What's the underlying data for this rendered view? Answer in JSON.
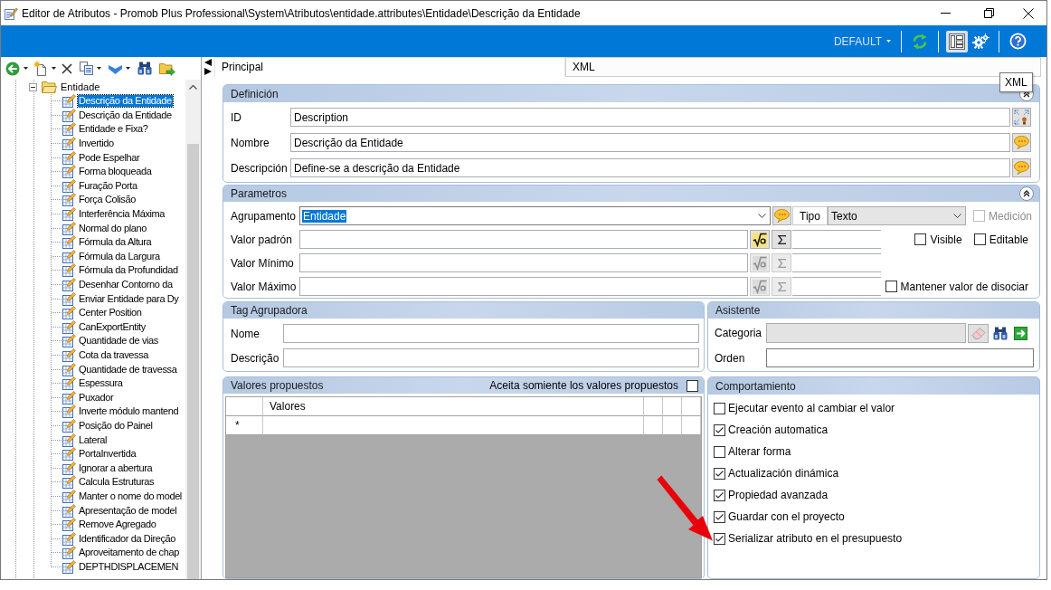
{
  "window": {
    "title": "Editor de Atributos - Promob Plus Professional\\System\\Atributos\\entidade.attributes\\Entidade\\Descrição da Entidade"
  },
  "header_bar": {
    "profile": "DEFAULT",
    "tool_groups": [
      [
        {
          "kind": "refresh",
          "on": false
        }
      ],
      [
        {
          "kind": "layout",
          "on": true
        },
        {
          "kind": "settings",
          "on": false
        }
      ],
      [
        {
          "kind": "help",
          "on": false
        }
      ]
    ]
  },
  "tree_toolbar": [
    {
      "kind": "back",
      "dropdown": true
    },
    {
      "kind": "new",
      "dropdown": true
    },
    {
      "kind": "delete",
      "dropdown": false
    },
    {
      "kind": "copy",
      "dropdown": true
    },
    {
      "kind": "move_down",
      "dropdown": true
    },
    {
      "kind": "find",
      "dropdown": false
    },
    {
      "kind": "import",
      "dropdown": false
    }
  ],
  "tree": {
    "label": "Entidade",
    "expanded": true,
    "children": [
      {
        "label": "Descrição da Entidade",
        "selected": true
      },
      {
        "label": "Descrição da Entidade",
        "selected": false
      },
      {
        "label": "Entidade e Fixa?",
        "selected": false
      },
      {
        "label": "Invertido",
        "selected": false
      },
      {
        "label": "Pode Espelhar",
        "selected": false
      },
      {
        "label": "Forma bloqueada",
        "selected": false
      },
      {
        "label": "Furação Porta",
        "selected": false
      },
      {
        "label": "Força Colisão",
        "selected": false
      },
      {
        "label": "Interferência Máxima",
        "selected": false
      },
      {
        "label": "Normal do plano",
        "selected": false
      },
      {
        "label": "Fórmula da Altura",
        "selected": false
      },
      {
        "label": "Fórmula da Largura",
        "selected": false
      },
      {
        "label": "Fórmula da Profundidad",
        "selected": false
      },
      {
        "label": "Desenhar Contorno da",
        "selected": false
      },
      {
        "label": "Enviar Entidade para Dy",
        "selected": false
      },
      {
        "label": "Center Position",
        "selected": false
      },
      {
        "label": "CanExportEntity",
        "selected": false
      },
      {
        "label": "Quantidade de vias",
        "selected": false
      },
      {
        "label": "Cota da travessa",
        "selected": false
      },
      {
        "label": "Quantidade de travessa",
        "selected": false
      },
      {
        "label": "Espessura",
        "selected": false
      },
      {
        "label": "Puxador",
        "selected": false
      },
      {
        "label": "Inverte módulo mantend",
        "selected": false
      },
      {
        "label": "Posição do Painel",
        "selected": false
      },
      {
        "label": "Lateral",
        "selected": false
      },
      {
        "label": "PortaInvertida",
        "selected": false
      },
      {
        "label": "Ignorar a abertura",
        "selected": false
      },
      {
        "label": "Calcula Estruturas",
        "selected": false
      },
      {
        "label": "Manter o nome do model",
        "selected": false
      },
      {
        "label": "Apresentação de model",
        "selected": false
      },
      {
        "label": "Remove Agregado",
        "selected": false
      },
      {
        "label": "Identificador da Direção",
        "selected": false
      },
      {
        "label": "Aproveitamento de chap",
        "selected": false
      },
      {
        "label": "DEPTHDISPLACEMEN",
        "selected": false
      }
    ]
  },
  "tabs": [
    {
      "label": "Principal",
      "selected": true
    },
    {
      "label": "XML",
      "selected": false
    }
  ],
  "tooltip": {
    "text": "XML"
  },
  "definicion": {
    "title": "Definición",
    "fields": [
      {
        "label": "ID",
        "value": "Description",
        "kind": "pick"
      },
      {
        "label": "Nombre",
        "value": "Descrição da Entidade",
        "kind": "translate"
      },
      {
        "label": "Descripción",
        "value": "Define-se a descrição da Entidade",
        "kind": "translate"
      }
    ]
  },
  "parametros": {
    "title": "Parametros",
    "grouping": {
      "label": "Agrupamento",
      "value": "Entidade",
      "selected": true
    },
    "type": {
      "label": "Tipo",
      "value": "Texto"
    },
    "measure": {
      "label": "Medición",
      "checked": false,
      "disabled": true
    },
    "value_rows": [
      {
        "label": "Valor padrón",
        "disabled": false,
        "options": [
          {
            "label": "Visible",
            "checked": false
          },
          {
            "label": "Editable",
            "checked": false
          }
        ]
      },
      {
        "label": "Valor Mínimo",
        "disabled": true
      },
      {
        "label": "Valor Máximo",
        "disabled": true,
        "options": [
          {
            "label": "Mantener valor de disociar",
            "checked": false
          }
        ]
      }
    ]
  },
  "tag_agrupadora": {
    "title": "Tag Agrupadora",
    "fields": [
      {
        "label": "Nome"
      },
      {
        "label": "Descrição"
      }
    ]
  },
  "asistente": {
    "title": "Asistente",
    "category": {
      "label": "Categoria",
      "disabled": true
    },
    "order": {
      "label": "Orden"
    }
  },
  "valores_propuestos": {
    "title": "Valores propuestos",
    "only_proposed": {
      "label": "Aceita somiente los valores propuestos",
      "checked": false
    },
    "columns": [
      "Valores"
    ],
    "new_row_marker": "*"
  },
  "comportamiento": {
    "title": "Comportamiento",
    "options": [
      {
        "label": "Ejecutar evento al cambiar el valor",
        "checked": false
      },
      {
        "label": "Creación automatica",
        "checked": true
      },
      {
        "label": "Alterar forma",
        "checked": false
      },
      {
        "label": "Actualización dinámica",
        "checked": true
      },
      {
        "label": "Propiedad avanzada",
        "checked": true
      },
      {
        "label": "Guardar con el proyecto",
        "checked": true
      },
      {
        "label": "Serializar atributo en el presupuesto",
        "checked": true
      }
    ]
  }
}
